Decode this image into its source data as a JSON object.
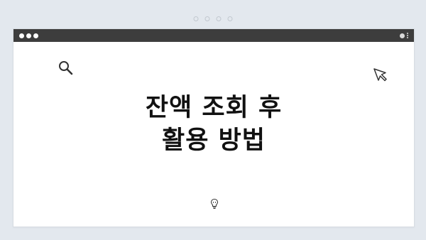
{
  "page": {
    "background_color": "#e3e8ee"
  },
  "window": {
    "titlebar_color": "#3d3d3d",
    "controls": [
      "dot",
      "dot",
      "dot"
    ],
    "right_icons": [
      "user-icon",
      "kebab-menu-icon"
    ]
  },
  "content": {
    "title_line1": "잔액 조회 후",
    "title_line2": "활용 방법",
    "icons": [
      "search-icon",
      "cursor-arrow-icon",
      "lightbulb-icon"
    ]
  }
}
